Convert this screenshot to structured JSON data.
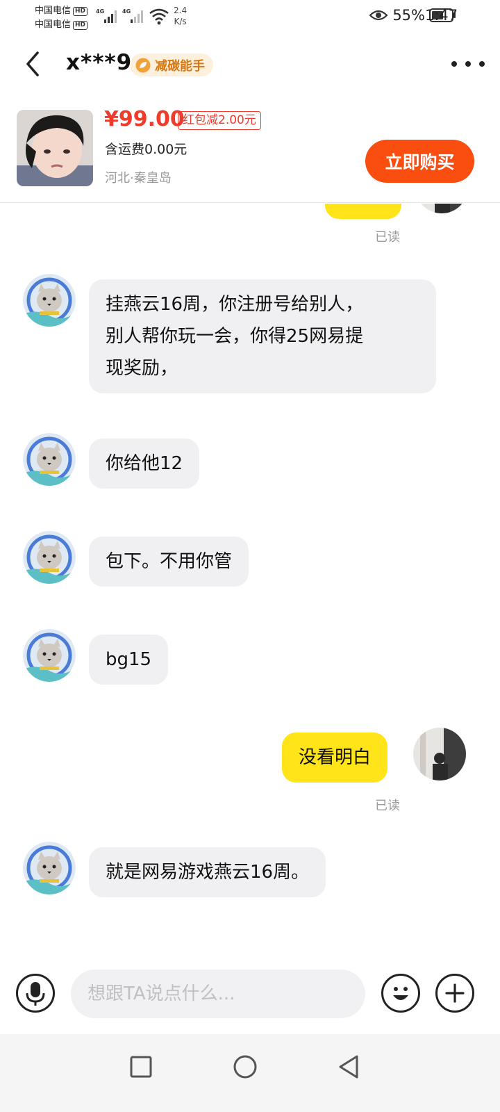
{
  "status_bar": {
    "carrier_1": "中国电信",
    "carrier_2": "中国电信",
    "hd_label": "HD",
    "net_type": "4G",
    "net_speed_value": "2.4",
    "net_speed_unit": "K/s",
    "battery_percent": "55%",
    "time": "1:47"
  },
  "header": {
    "username": "x***9",
    "badge_label": "减碳能手",
    "badge_color": "#d87813"
  },
  "product": {
    "price": "¥99.00",
    "coupon": "红包减2.00元",
    "shipping": "含运费0.00元",
    "location": "河北·秦皇岛",
    "buy_label": "立即购买",
    "price_color": "#ef3b2c",
    "buy_color": "#fa4d10"
  },
  "chat": {
    "read_label": "已读",
    "messages": [
      {
        "side": "in",
        "lines": [
          "挂燕云16周，你注册号给别人，",
          "别人帮你玩一会，你得25网易提",
          "现奖励，"
        ]
      },
      {
        "side": "in",
        "lines": [
          "你给他12"
        ]
      },
      {
        "side": "in",
        "lines": [
          "包下。不用你管"
        ]
      },
      {
        "side": "in",
        "lines": [
          "bg15"
        ]
      },
      {
        "side": "out",
        "lines": [
          "没看明白"
        ]
      },
      {
        "side": "in",
        "lines": [
          "就是网易游戏燕云16周。"
        ]
      }
    ],
    "out_bubble_color": "#ffe41a",
    "in_bubble_color": "#f0f0f2"
  },
  "input_bar": {
    "placeholder": "想跟TA说点什么..."
  },
  "icons": {
    "back": "chevron-left-icon",
    "more": "more-dots-icon",
    "voice": "microphone-icon",
    "emoji": "emoji-icon",
    "add": "plus-icon",
    "nav_recent": "square-icon",
    "nav_home": "circle-icon",
    "nav_back": "triangle-back-icon"
  }
}
